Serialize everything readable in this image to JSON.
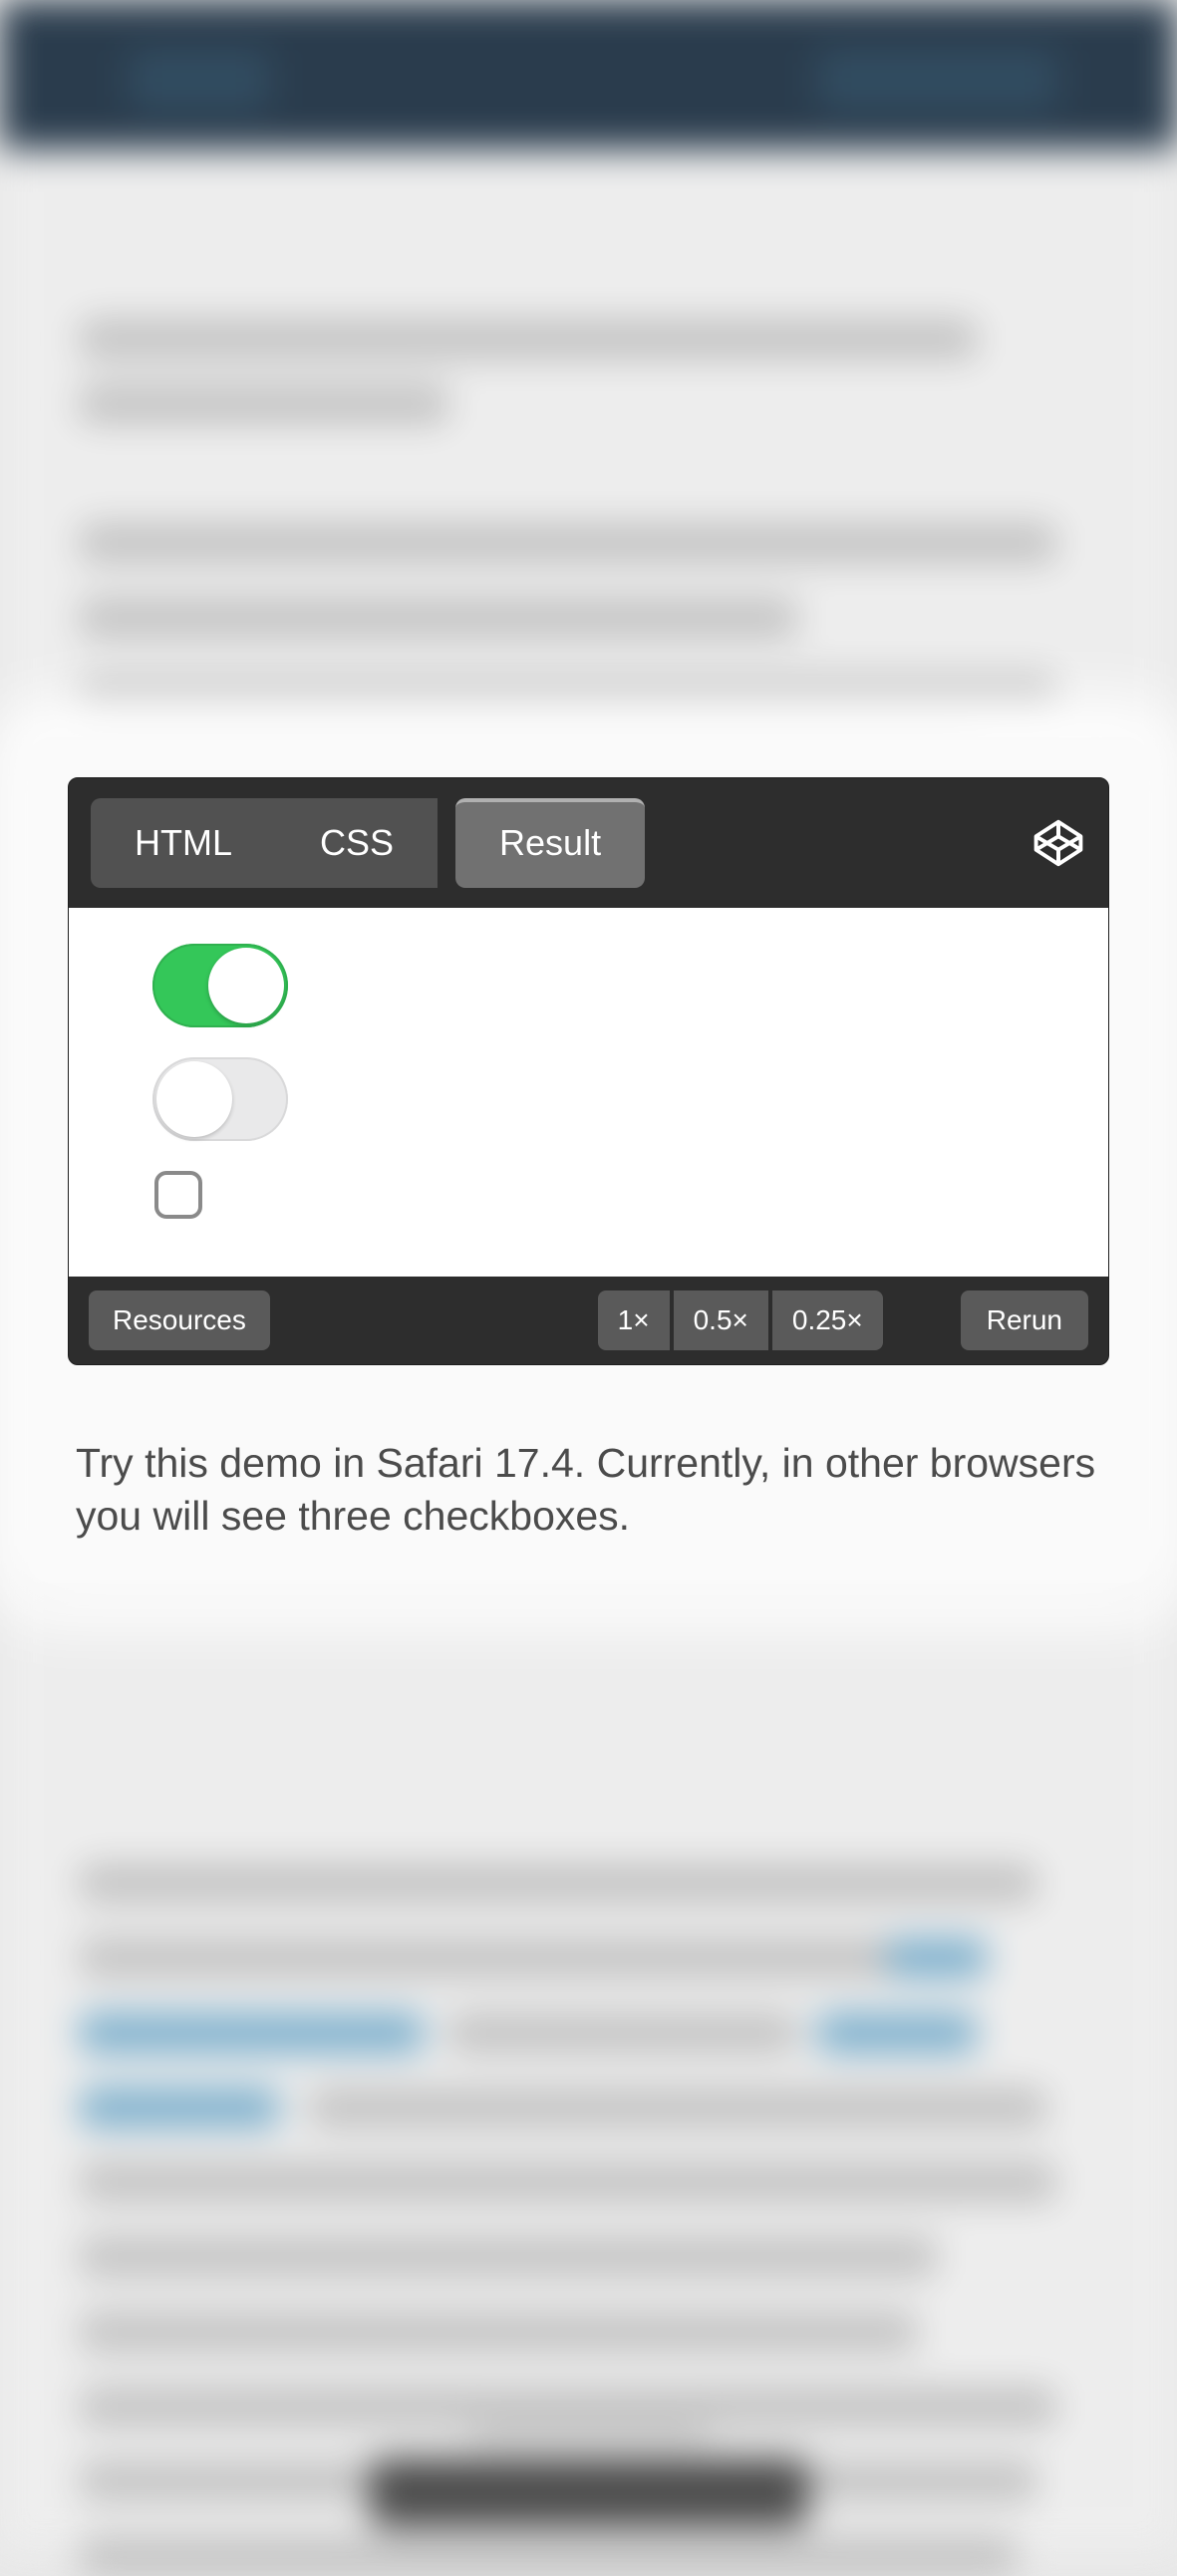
{
  "embed": {
    "tabs": {
      "html": "HTML",
      "css": "CSS",
      "result": "Result"
    },
    "footer": {
      "resources": "Resources",
      "zoom": [
        "1×",
        "0.5×",
        "0.25×"
      ],
      "rerun": "Rerun"
    }
  },
  "caption": "Try this demo in Safari 17.4. Currently, in other browsers you will see three checkboxes.",
  "colors": {
    "switch_on": "#34c759",
    "embed_bg": "#2d2d2d"
  }
}
